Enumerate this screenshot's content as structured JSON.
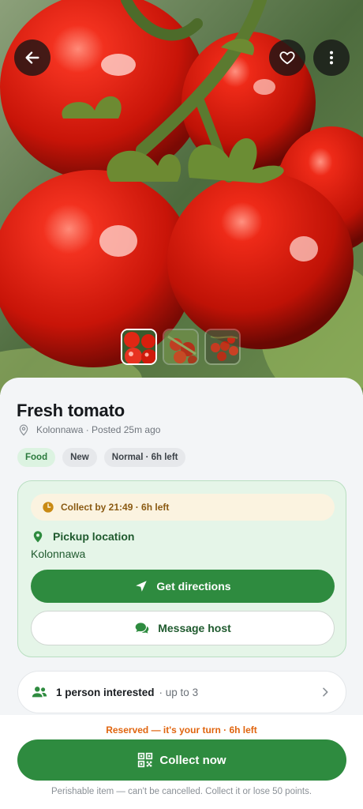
{
  "header": {
    "back_icon": "arrow-left-icon",
    "favorite_icon": "heart-outline-icon",
    "more_icon": "more-vertical-icon"
  },
  "gallery": {
    "image_count": 3,
    "selected_index": 0
  },
  "listing": {
    "title": "Fresh tomato",
    "meta": "Kolonnawa · Posted 25m ago",
    "tags": [
      "Food",
      "New",
      "Normal · 6h left"
    ]
  },
  "pickup": {
    "collect_by": "Collect by 21:49 · 6h left",
    "heading": "Pickup location",
    "place": "Kolonnawa",
    "directions_label": "Get directions",
    "message_label": "Message host"
  },
  "interest": {
    "count_text": "1 person interested",
    "limit_text": "· up to 3"
  },
  "footer": {
    "reserved_text": "Reserved — it's your turn · 6h left",
    "collect_label": "Collect now",
    "disclaimer": "Perishable item — can't be cancelled. Collect it or lose 50 points."
  },
  "colors": {
    "primary_green": "#2e8b3f",
    "light_green": "#e5f5e8",
    "warning_orange": "#e0650f",
    "amber": "#c98a14"
  }
}
